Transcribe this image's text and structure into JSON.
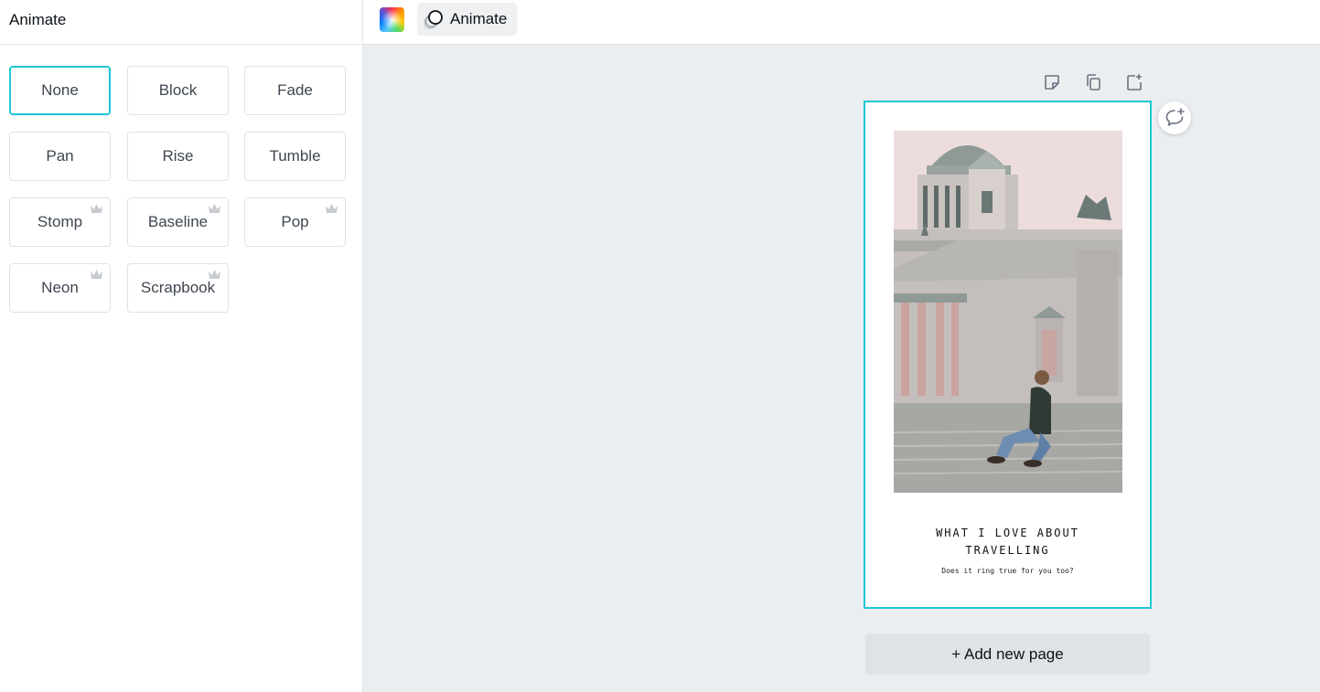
{
  "panel": {
    "title": "Animate",
    "effects": [
      {
        "label": "None",
        "selected": true,
        "premium": false
      },
      {
        "label": "Block",
        "selected": false,
        "premium": false
      },
      {
        "label": "Fade",
        "selected": false,
        "premium": false
      },
      {
        "label": "Pan",
        "selected": false,
        "premium": false
      },
      {
        "label": "Rise",
        "selected": false,
        "premium": false
      },
      {
        "label": "Tumble",
        "selected": false,
        "premium": false
      },
      {
        "label": "Stomp",
        "selected": false,
        "premium": true
      },
      {
        "label": "Baseline",
        "selected": false,
        "premium": true
      },
      {
        "label": "Pop",
        "selected": false,
        "premium": true
      },
      {
        "label": "Neon",
        "selected": false,
        "premium": true
      },
      {
        "label": "Scrapbook",
        "selected": false,
        "premium": true
      }
    ]
  },
  "toolbar": {
    "color_icon": "color-palette-icon",
    "animate_label": "Animate",
    "animate_icon": "animate-circles-icon"
  },
  "canvas": {
    "page_tools": [
      "notes-icon",
      "duplicate-page-icon",
      "add-page-icon"
    ],
    "comment_icon": "add-comment-icon",
    "design": {
      "title": "WHAT I LOVE ABOUT TRAVELLING",
      "subtitle": "Does it ring true for you too?",
      "photo": "cathedral-woman-sitting-photo"
    },
    "add_page_label": "+ Add new page"
  },
  "colors": {
    "accent": "#1fc7d4",
    "canvas_bg": "#ebeef1",
    "button_bg": "#dfe2e6",
    "crown": "#c8ccd1"
  }
}
